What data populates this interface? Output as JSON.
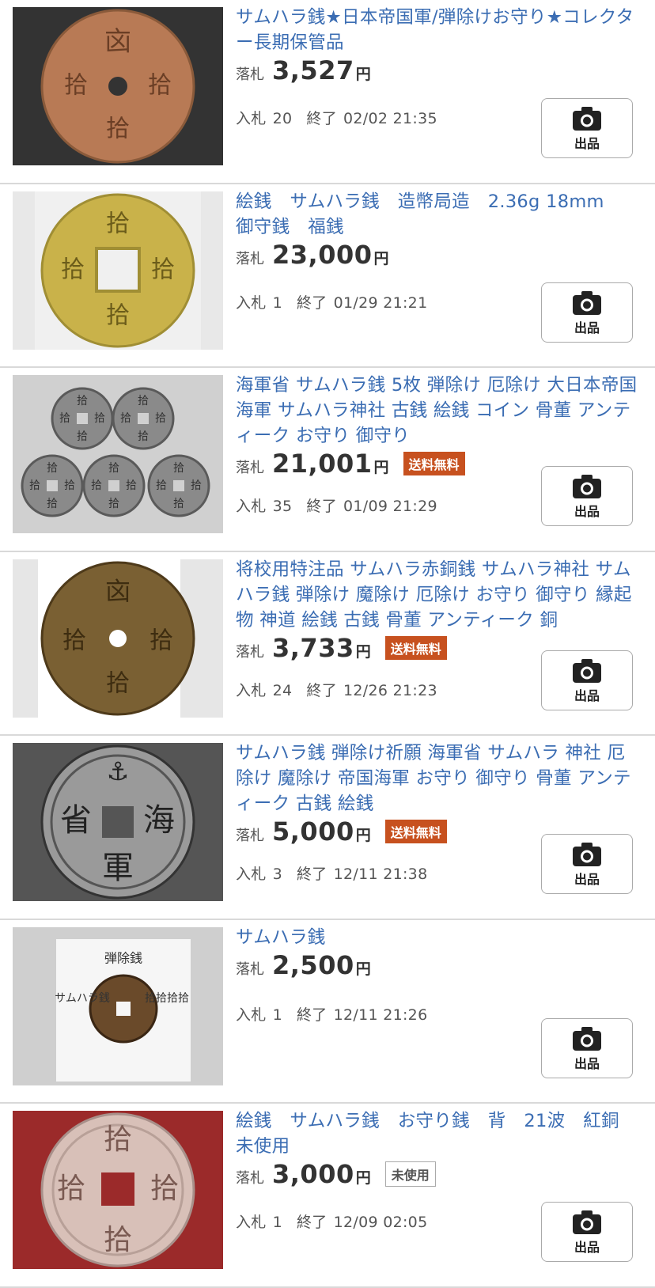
{
  "labels": {
    "price_prefix": "落札",
    "bids_prefix": "入札",
    "end_prefix": "終了",
    "yen": "円",
    "sell_button": "出品"
  },
  "colors": {
    "title": "#3b6db3",
    "free_shipping_badge": "#c7511f",
    "divider": "#d9d9d9"
  },
  "items": [
    {
      "title": "サムハラ銭★日本帝国軍/弾除けお守り★コレクター長期保管品",
      "price": "3,527",
      "badge": null,
      "bids": "20",
      "end": "02/02 21:35"
    },
    {
      "title": "絵銭　サムハラ銭　造幣局造　2.36g 18mm　御守銭　福銭",
      "price": "23,000",
      "badge": null,
      "bids": "1",
      "end": "01/29 21:21"
    },
    {
      "title": "海軍省 サムハラ銭 5枚 弾除け 厄除け 大日本帝国海軍 サムハラ神社 古銭 絵銭 コイン 骨董 アンティーク お守り 御守り",
      "price": "21,001",
      "badge": "送料無料",
      "bids": "35",
      "end": "01/09 21:29"
    },
    {
      "title": "将校用特注品 サムハラ赤銅銭 サムハラ神社 サムハラ銭 弾除け 魔除け 厄除け お守り 御守り 縁起物 神道 絵銭 古銭 骨董 アンティーク 銅",
      "price": "3,733",
      "badge": "送料無料",
      "bids": "24",
      "end": "12/26 21:23"
    },
    {
      "title": "サムハラ銭 弾除け祈願 海軍省 サムハラ 神社 厄除け 魔除け 帝国海軍 お守り 御守り 骨董 アンティーク 古銭 絵銭",
      "price": "5,000",
      "badge": "送料無料",
      "bids": "3",
      "end": "12/11 21:38"
    },
    {
      "title": "サムハラ銭",
      "price": "2,500",
      "badge": null,
      "bids": "1",
      "end": "12/11 21:26"
    },
    {
      "title": "絵銭　サムハラ銭　お守り銭　背　21波　紅銅　未使用",
      "price": "3,000",
      "badge": "未使用",
      "bids": "1",
      "end": "12/09 02:05"
    }
  ],
  "thumbnails": [
    {
      "name": "copper-coin-round-hole",
      "bg": "#333333",
      "coin": "#b87a55",
      "glyphs": [
        "㐫",
        "拾",
        "拾",
        "拾"
      ]
    },
    {
      "name": "brass-coin-square-hole",
      "bg": "#e8e8e8",
      "coin": "#c9b24a",
      "glyphs": [
        "拾",
        "拾",
        "拾",
        "拾"
      ]
    },
    {
      "name": "five-silver-coins",
      "bg": "#d0d0d0",
      "coin": "#8a8a8a",
      "glyphs": []
    },
    {
      "name": "bronze-coin-round-hole",
      "bg": "#e6e6e6",
      "coin": "#7a6033",
      "glyphs": []
    },
    {
      "name": "silver-navy-coin",
      "bg": "#555555",
      "coin": "#9a9a9a",
      "glyphs": [
        "海",
        "軍",
        "省",
        "⚓"
      ]
    },
    {
      "name": "coin-on-card-with-notes",
      "bg": "#cfcfcf",
      "coin": "#6a4a2a",
      "glyphs": [
        "弾除銭",
        "サムハラ銭",
        "拾拾拾拾"
      ]
    },
    {
      "name": "copper-coin-on-red",
      "bg": "#9b2a2a",
      "coin": "#d8c0b8",
      "glyphs": []
    }
  ]
}
